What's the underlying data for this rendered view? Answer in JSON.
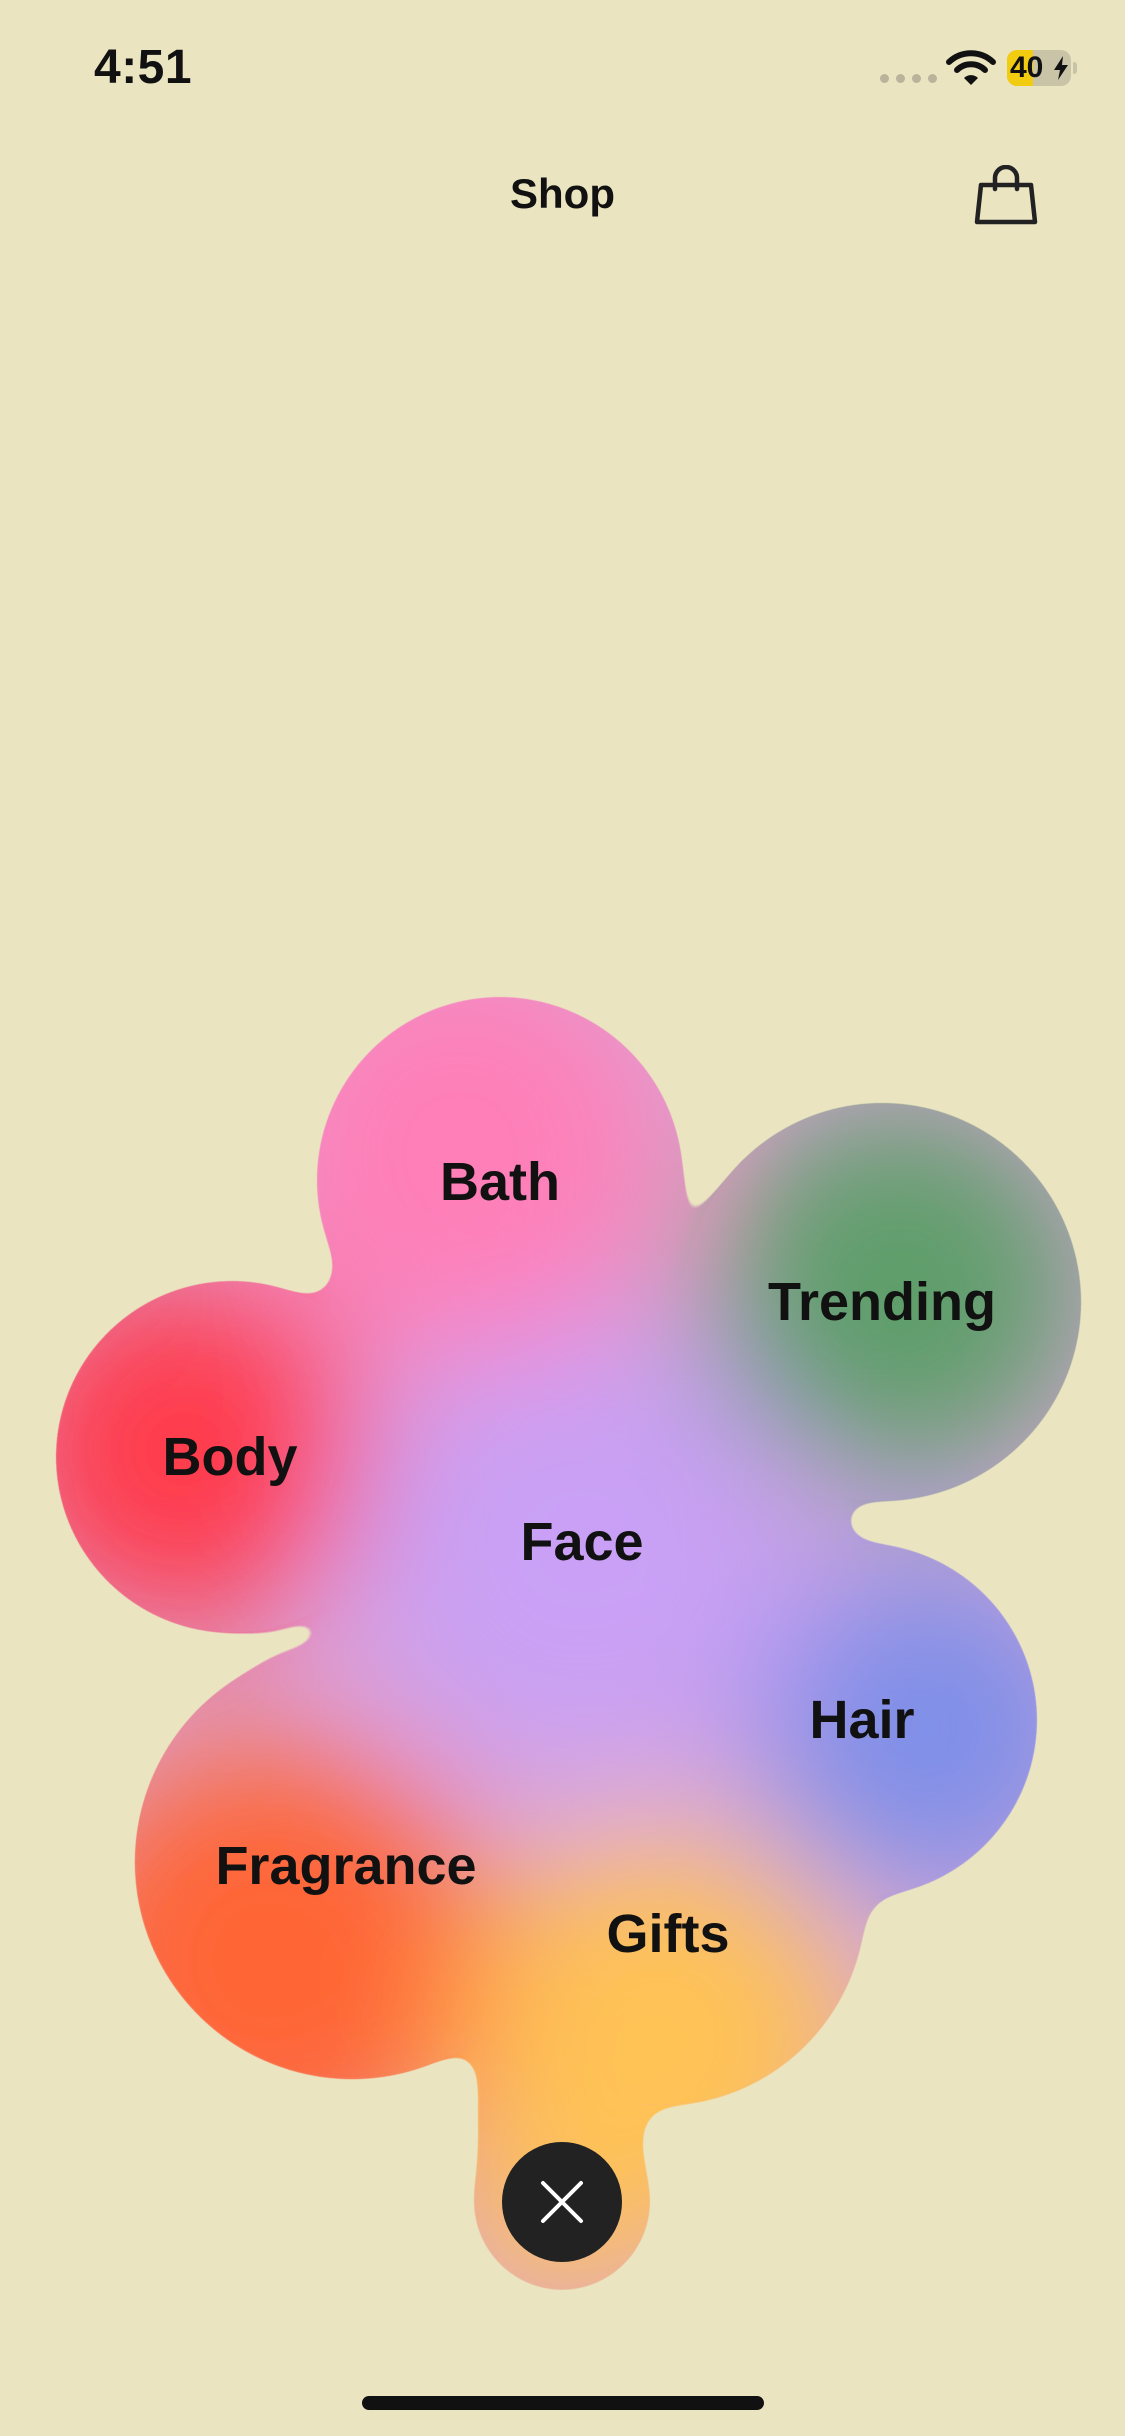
{
  "status_bar": {
    "time": "4:51",
    "battery_percent": "40",
    "battery_level": 0.4,
    "icons": [
      "signal-dots-icon",
      "wifi-icon",
      "battery-icon",
      "charging-bolt-icon"
    ]
  },
  "nav": {
    "title": "Shop",
    "cart_icon": "shopping-bag-icon"
  },
  "menu": {
    "categories": [
      {
        "label": "Bath"
      },
      {
        "label": "Trending"
      },
      {
        "label": "Body"
      },
      {
        "label": "Face"
      },
      {
        "label": "Hair"
      },
      {
        "label": "Fragrance"
      },
      {
        "label": "Gifts"
      }
    ],
    "close_icon": "close-icon"
  },
  "colors": {
    "background": "#EAE4C1",
    "bath": "#FF7FB8",
    "trending": "#5F9E6A",
    "body": "#FF3A4C",
    "face": "#C9A0F5",
    "hair": "#7F8FE8",
    "fragrance": "#FF6536",
    "gifts": "#FFC255",
    "close_button": "#222222"
  }
}
